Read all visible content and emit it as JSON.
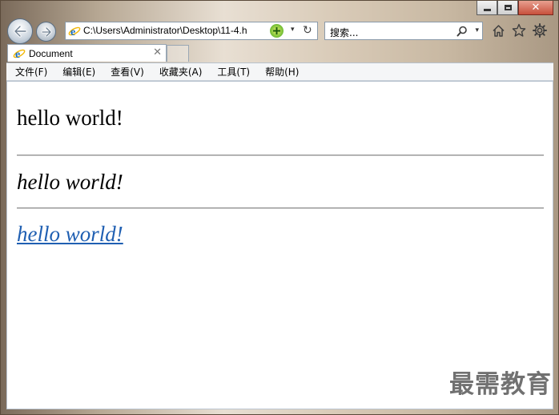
{
  "window": {
    "caption_buttons": {
      "minimize_icon": "minimize-icon",
      "maximize_icon": "maximize-icon",
      "close_glyph": "✕"
    }
  },
  "nav": {
    "back_icon": "arrow-left-icon",
    "forward_icon": "arrow-right-icon",
    "address_value": "C:\\Users\\Administrator\\Desktop\\11-4.h",
    "compat_icon": "compatibility-view-icon",
    "address_dropdown_glyph": "▾",
    "refresh_glyph": "↻",
    "search_placeholder": "搜索...",
    "search_dropdown_glyph": "▾",
    "tool_icons": [
      "home-icon",
      "favorites-star-icon",
      "gear-icon"
    ]
  },
  "tabs": [
    {
      "title": "Document",
      "close_glyph": "✕"
    }
  ],
  "menubar": {
    "items": [
      "文件(F)",
      "编辑(E)",
      "查看(V)",
      "收藏夹(A)",
      "工具(T)",
      "帮助(H)"
    ]
  },
  "page": {
    "plain_text": "hello world!",
    "italic_text": "hello world!",
    "link_text": "hello world!"
  },
  "colors": {
    "link": "#1f5fb2",
    "close_button": "#c7503c"
  },
  "watermark": "最需教育"
}
